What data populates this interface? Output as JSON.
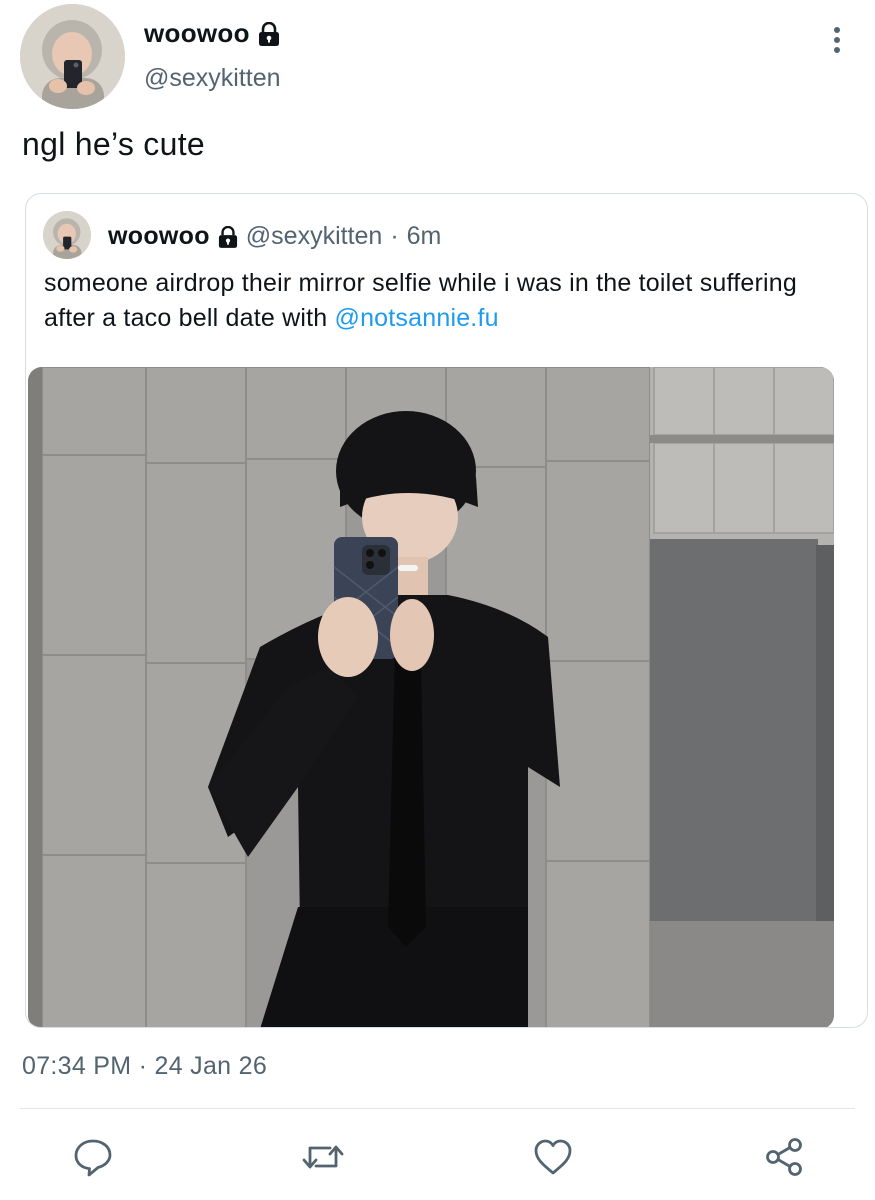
{
  "tweet": {
    "author": {
      "display_name": "woowoo",
      "handle": "@sexykitten",
      "protected_icon": "lock-icon"
    },
    "more_icon": "more-vertical-icon",
    "text": "ngl he’s cute",
    "timestamp": "07:34 PM · 24 Jan 26"
  },
  "quoted": {
    "author": {
      "display_name": "woowoo",
      "handle": "@sexykitten",
      "separator": "·",
      "time": "6m"
    },
    "text_before": "someone airdrop their mirror selfie while i was in the toilet suffering after a taco bell date with ",
    "mention": "@notsannie.fu",
    "media_icon": "photo-mirror-selfie"
  },
  "actions": {
    "reply_icon": "reply-icon",
    "retweet_icon": "retweet-icon",
    "like_icon": "heart-icon",
    "share_icon": "share-icon"
  },
  "colors": {
    "text": "#0f1419",
    "secondary": "#536471",
    "accent": "#1d9bf0",
    "border": "#d6dde3"
  }
}
